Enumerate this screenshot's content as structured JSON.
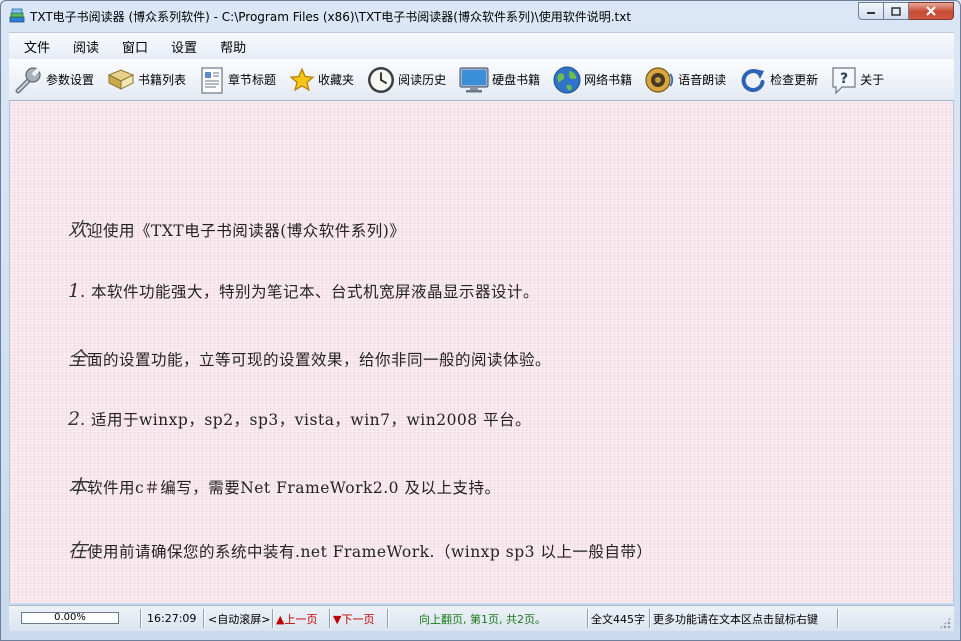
{
  "window": {
    "title": "TXT电子书阅读器 (博众系列软件) - C:\\Program Files (x86)\\TXT电子书阅读器(博众软件系列)\\使用软件说明.txt"
  },
  "menu": [
    "文件",
    "阅读",
    "窗口",
    "设置",
    "帮助"
  ],
  "toolbar": [
    {
      "label": "参数设置",
      "icon": "wrench-icon"
    },
    {
      "label": "书籍列表",
      "icon": "books-icon"
    },
    {
      "label": "章节标题",
      "icon": "document-icon"
    },
    {
      "label": "收藏夹",
      "icon": "star-icon"
    },
    {
      "label": "阅读历史",
      "icon": "clock-icon"
    },
    {
      "label": "硬盘书籍",
      "icon": "monitor-icon"
    },
    {
      "label": "网络书籍",
      "icon": "globe-icon"
    },
    {
      "label": "语音朗读",
      "icon": "speaker-icon"
    },
    {
      "label": "检查更新",
      "icon": "refresh-icon"
    },
    {
      "label": "关于",
      "icon": "help-icon"
    }
  ],
  "content": {
    "lines": [
      {
        "first": "欢",
        "rest": "迎使用《TXT电子书阅读器(博众软件系列)》"
      },
      {
        "first": "1",
        "rest": ". 本软件功能强大，特别为笔记本、台式机宽屏液晶显示器设计。"
      },
      {
        "first": "全",
        "rest": "面的设置功能，立等可现的设置效果，给你非同一般的阅读体验。"
      },
      {
        "first": "2",
        "rest": ". 适用于winxp，sp2，sp3，vista，win7，win2008 平台。"
      },
      {
        "first": "本",
        "rest": "软件用c＃编写，需要Net  FrameWork2.0 及以上支持。"
      },
      {
        "first": "在",
        "rest": "使用前请确保您的系统中装有.net  FrameWork.（winxp  sp3 以上一般自带）"
      }
    ]
  },
  "status": {
    "progress_text": "0.00%",
    "progress_value": 0.0,
    "time": "16:27:09",
    "auto_scroll": "<自动滚屏>",
    "prev_page": "▲上一页",
    "next_page": "▼下一页",
    "page_info": "向上翻页, 第1页, 共2页。",
    "word_count": "全文445字",
    "hint": "更多功能请在文本区点击鼠标右键"
  }
}
